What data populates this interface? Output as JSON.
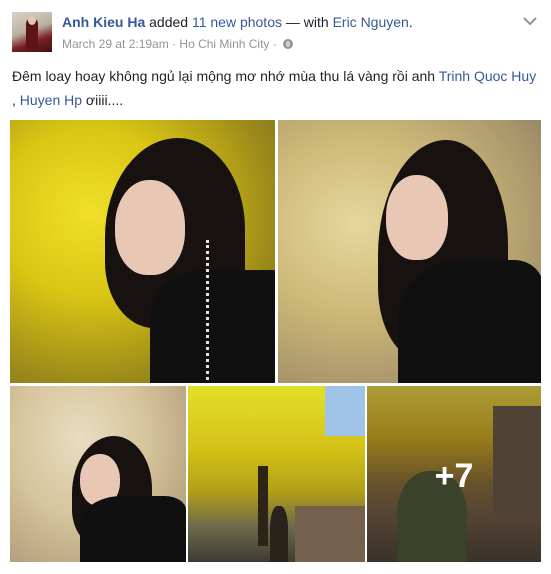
{
  "post": {
    "author": "Anh Kieu Ha",
    "action_text": " added ",
    "photos_link": "11 new photos",
    "with_text": " — with ",
    "tagged_person": "Eric Nguyen",
    "headline_end": ".",
    "timestamp": "March 29 at 2:19am",
    "separator": " · ",
    "location": "Ho Chi Minh City",
    "separator2": " · ",
    "privacy_icon": "globe-icon",
    "menu_icon": "chevron-down-icon"
  },
  "message": {
    "text_before": "Đêm loay hoay không ngủ lại mộng mơ nhớ mùa thu lá vàng rồi anh ",
    "tag1": "Trinh Quoc Huy",
    "middle": " , ",
    "tag2": "Huyen Hp",
    "text_after": " ơiiii...."
  },
  "photos": {
    "more_count": "+7"
  },
  "colors": {
    "link": "#365899",
    "meta": "#90949c",
    "text": "#1d2129"
  }
}
